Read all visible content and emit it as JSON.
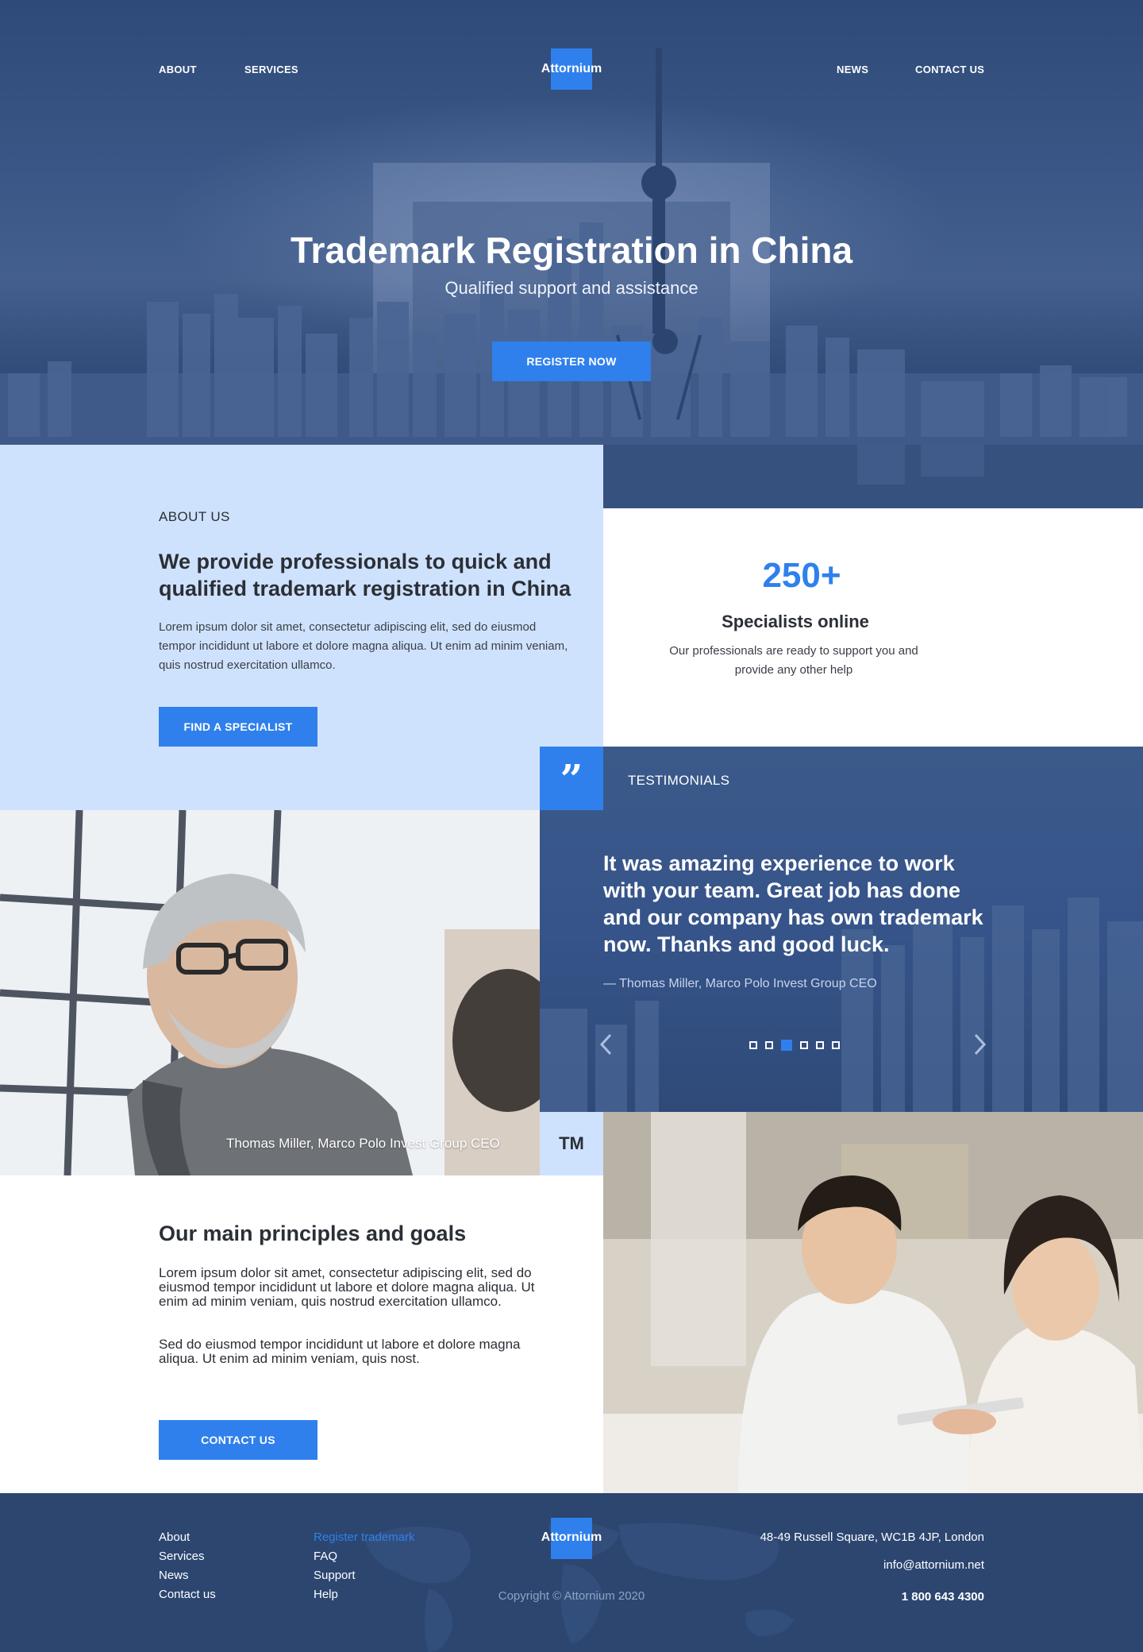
{
  "nav": {
    "left": [
      "ABOUT",
      "SERVICES"
    ],
    "right": [
      "NEWS",
      "CONTACT US"
    ],
    "logo": "Attornium"
  },
  "hero": {
    "title": "Trademark Registration in China",
    "subtitle": "Qualified support and assistance",
    "cta": "REGISTER NOW"
  },
  "about": {
    "eyebrow": "ABOUT US",
    "heading": "We provide professionals to quick and qualified trademark registration in China",
    "body": "Lorem ipsum dolor sit amet, consectetur adipiscing elit, sed do eiusmod tempor incididunt ut labore et dolore magna aliqua. Ut enim ad minim veniam, quis nostrud exercitation ullamco.",
    "cta": "FIND A SPECIALIST"
  },
  "stats": {
    "number": "250+",
    "title": "Specialists online",
    "desc": "Our professionals are ready to support you and provide any other help"
  },
  "testimonials": {
    "label": "TESTIMONIALS",
    "quote_mark": "”",
    "quote": "It was amazing experience to work with your team. Great job has done and our company has own trademark now. Thanks and good luck.",
    "author": "— Thomas Miller, Marco Polo Invest Group CEO",
    "prev_icon": "chevron-left-icon",
    "next_icon": "chevron-right-icon",
    "dot_count": 6,
    "active_dot": 3
  },
  "photo": {
    "caption": "Thomas Miller, Marco Polo Invest Group CEO",
    "tm": "TM"
  },
  "principles": {
    "heading": "Our main principles and goals",
    "p1": "Lorem ipsum dolor sit amet, consectetur adipiscing elit, sed do eiusmod tempor incididunt ut labore et dolore magna aliqua. Ut enim ad minim veniam, quis nostrud exercitation ullamco.",
    "p2": "Sed do eiusmod tempor incididunt ut labore et dolore magna aliqua. Ut enim ad minim veniam, quis nost.",
    "cta": "CONTACT US"
  },
  "footer": {
    "col1": [
      "About",
      "Services",
      "News",
      "Contact us"
    ],
    "col2": [
      "Register trademark",
      "FAQ",
      "Support",
      "Help"
    ],
    "logo": "Attornium",
    "copyright": "Copyright © Attornium 2020",
    "address": "48-49 Russell Square, WC1B 4JP, London",
    "email": "info@attornium.net",
    "phone": "1 800 643 4300"
  },
  "colors": {
    "accent": "#2f80ed",
    "navy": "#2c4670",
    "light_blue": "#cfe2fd"
  }
}
